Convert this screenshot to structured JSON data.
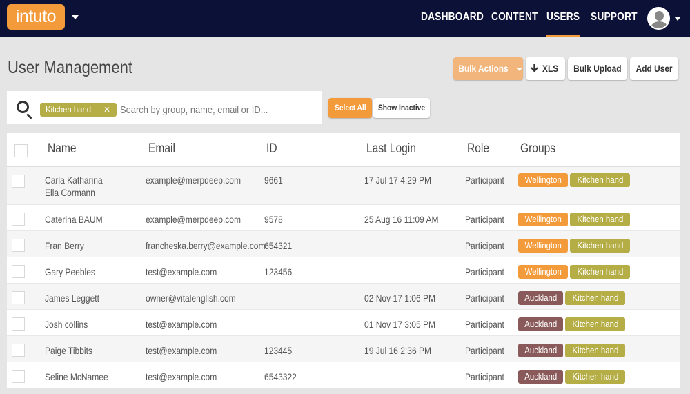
{
  "app": {
    "logo_text": "intuto"
  },
  "nav": {
    "items": [
      {
        "label": "DASHBOARD"
      },
      {
        "label": "CONTENT"
      },
      {
        "label": "USERS",
        "active": true
      },
      {
        "label": "SUPPORT"
      }
    ]
  },
  "page": {
    "title": "User Management"
  },
  "actions": {
    "bulk_label": "Bulk Actions",
    "xls_label": "XLS",
    "upload_label": "Bulk Upload",
    "add_user_label": "Add User"
  },
  "search": {
    "filter_chip": "Kitchen hand",
    "placeholder": "Search by group, name, email or ID...",
    "select_all_label": "Select All",
    "show_inactive_label": "Show Inactive"
  },
  "table": {
    "columns": [
      "Name",
      "Email",
      "ID",
      "Last Login",
      "Role",
      "Groups"
    ],
    "rows": [
      {
        "name_line1": "Carla Katharina",
        "name_line2": "Ella Cormann",
        "email": "example@merpdeep.com",
        "id": "9661",
        "last_login": "17 Jul 17 4:29 PM",
        "role": "Participant",
        "groups": [
          "Wellington",
          "Kitchen hand"
        ]
      },
      {
        "name_line1": "Caterina BAUM",
        "email": "example@merpdeep.com",
        "id": "9578",
        "last_login": "25 Aug 16 11:09 AM",
        "role": "Participant",
        "groups": [
          "Wellington",
          "Kitchen hand"
        ]
      },
      {
        "name_line1": "Fran Berry",
        "email": "francheska.berry@example.com",
        "id": "654321",
        "last_login": "",
        "role": "Participant",
        "groups": [
          "Wellington",
          "Kitchen hand"
        ]
      },
      {
        "name_line1": "Gary Peebles",
        "email": "test@example.com",
        "id": "123456",
        "last_login": "",
        "role": "Participant",
        "groups": [
          "Wellington",
          "Kitchen hand"
        ]
      },
      {
        "name_line1": "James Leggett",
        "email": "owner@vitalenglish.com",
        "id": "",
        "last_login": "02 Nov 17 1:06 PM",
        "role": "Participant",
        "groups": [
          "Auckland",
          "Kitchen hand"
        ]
      },
      {
        "name_line1": "Josh collins",
        "email": "test@example.com",
        "id": "",
        "last_login": "01 Nov 17 3:05 PM",
        "role": "Participant",
        "groups": [
          "Auckland",
          "Kitchen hand"
        ]
      },
      {
        "name_line1": "Paige Tibbits",
        "email": "test@example.com",
        "id": "123445",
        "last_login": "19 Jul 16 2:36 PM",
        "role": "Participant",
        "groups": [
          "Auckland",
          "Kitchen hand"
        ]
      },
      {
        "name_line1": "Seline McNamee",
        "email": "test@example.com",
        "id": "6543322",
        "last_login": "",
        "role": "Participant",
        "groups": [
          "Auckland",
          "Kitchen hand"
        ]
      }
    ]
  },
  "colors": {
    "brand_orange": "#f39a3a",
    "nav_bg": "#0c1137",
    "tag_wellington": "#f39a3a",
    "tag_auckland": "#8a5a5a",
    "tag_kitchen": "#b5ad45"
  }
}
